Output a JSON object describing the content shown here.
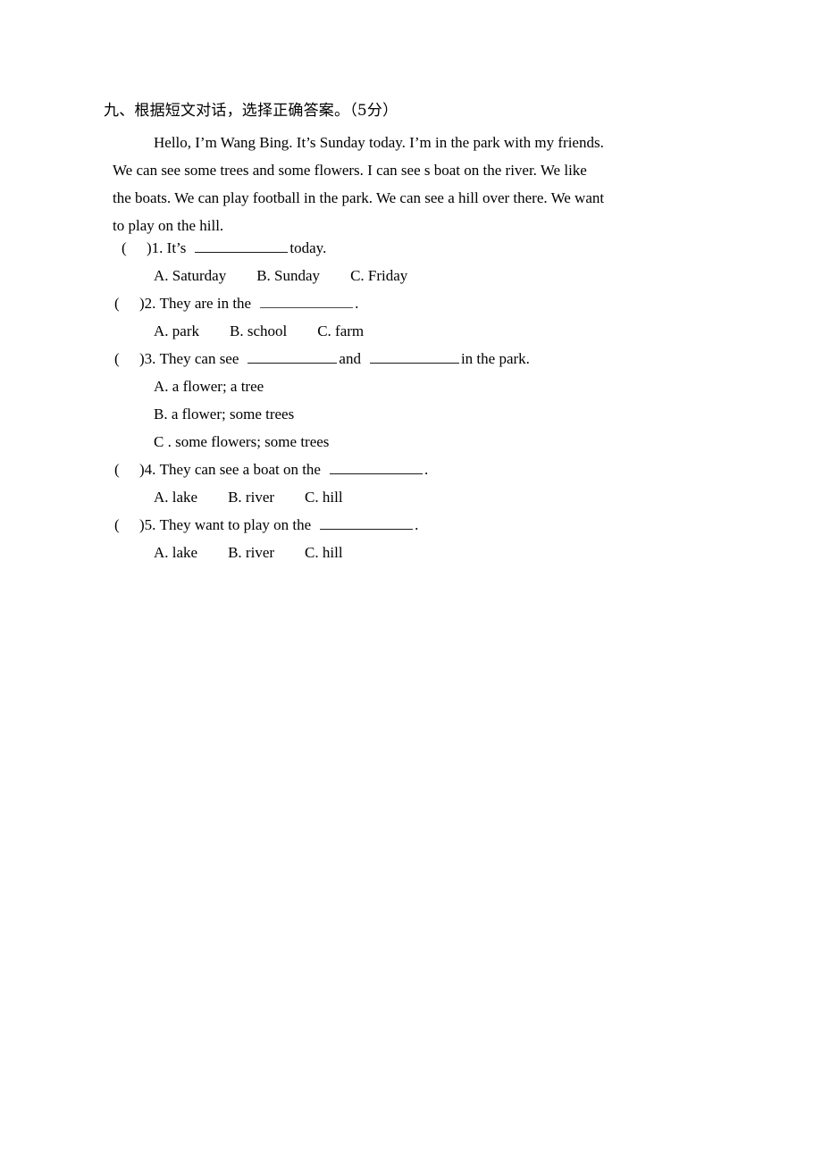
{
  "section": {
    "heading": "九、根据短文对话，选择正确答案。（5分）"
  },
  "passage": {
    "lines": [
      "Hello, I’m Wang Bing. It’s Sunday today. I’m in the park with my friends.",
      "We can see some trees and some flowers. I can see s boat on the river. We like",
      "the boats. We can play football in the park. We can see a hill over there. We want",
      "to play on the hill."
    ]
  },
  "questions": [
    {
      "paren": "(",
      "close": ")",
      "number": "1.",
      "stem_before": "It’s",
      "stem_after": "today.",
      "options": [
        "A. Saturday",
        "B. Sunday",
        "C. Friday"
      ]
    },
    {
      "paren": "(",
      "close": ")",
      "number": "2.",
      "stem_before": "They are in the",
      "stem_after": ".",
      "options": [
        "A. park",
        "B. school",
        "C. farm"
      ]
    },
    {
      "paren": "(",
      "close": ")",
      "number": "3.",
      "stem_before": "They can see",
      "stem_middle": "and",
      "stem_after": "in the park.",
      "options": [
        "A. a flower; a tree",
        "B. a flower; some trees",
        "C . some flowers; some trees"
      ]
    },
    {
      "paren": "(",
      "close": ")",
      "number": "4.",
      "stem_before": "They can see a boat on the",
      "stem_after": ".",
      "options": [
        "A. lake",
        "B. river",
        "C. hill"
      ]
    },
    {
      "paren": "(",
      "close": ")",
      "number": "5.",
      "stem_before": "They want to play on the",
      "stem_after": ".",
      "options": [
        "A. lake",
        "B. river",
        "C. hill"
      ]
    }
  ]
}
